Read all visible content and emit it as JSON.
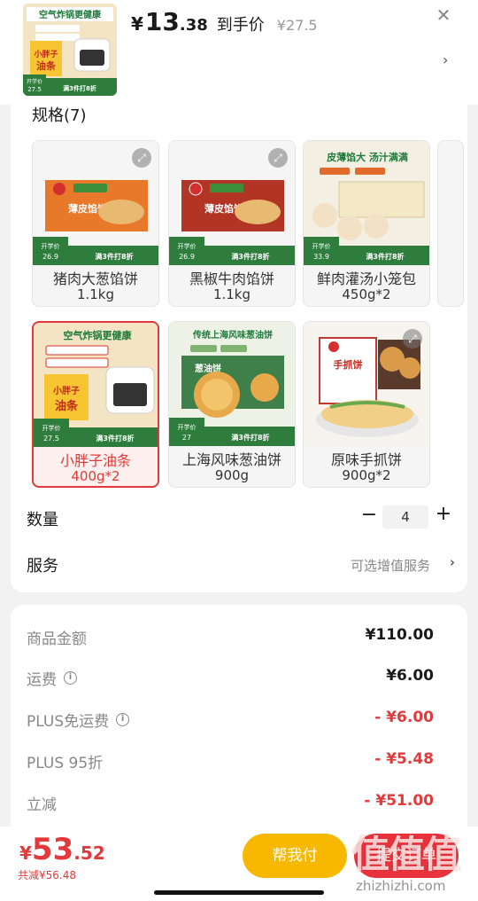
{
  "header": {
    "price_yen": "¥",
    "price_int": "13",
    "price_dec": ".38",
    "price_hand": "到手价",
    "price_orig": "¥27.5",
    "close_icon": "close-icon",
    "chevron_icon": "chevron-right-icon"
  },
  "spec": {
    "title": "规格(7)",
    "items": [
      {
        "name": "猪肉大葱馅饼",
        "sub": "1.1kg",
        "pkg_text": "薄皮馅饼",
        "band_label": "开学价",
        "band_price": "26.9",
        "promo": "满3件打8折",
        "selected": false
      },
      {
        "name": "黑椒牛肉馅饼",
        "sub": "1.1kg",
        "pkg_text": "薄皮馅饼",
        "band_label": "开学价",
        "band_price": "26.9",
        "promo": "满3件打8折",
        "selected": false
      },
      {
        "name": "鲜肉灌汤小笼包",
        "sub": "450g*2",
        "pkg_text": "皮薄馅大 汤汁满满",
        "band_label": "开学价",
        "band_price": "33.9",
        "promo": "满3件打8折",
        "selected": false
      },
      {
        "name": "小胖子油条",
        "sub": "400g*2",
        "pkg_text": "空气炸锅更健康",
        "band_label": "开学价",
        "band_price": "27.5",
        "promo": "满3件打8折",
        "selected": true
      },
      {
        "name": "上海风味葱油饼",
        "sub": "900g",
        "pkg_text": "传统上海风味葱油饼",
        "band_label": "开学价",
        "band_price": "27",
        "promo": "满3件打8折",
        "selected": false
      },
      {
        "name": "原味手抓饼",
        "sub": "900g*2",
        "pkg_text": "手抓饼",
        "band_label": "",
        "band_price": "",
        "promo": "",
        "selected": false
      }
    ]
  },
  "quantity": {
    "label": "数量",
    "minus": "−",
    "value": "4",
    "plus": "+"
  },
  "service": {
    "label": "服务",
    "value": "可选增值服务",
    "chevron": "›"
  },
  "breakdown": [
    {
      "label": "商品金额",
      "value": "¥110.00",
      "info": false,
      "red": false
    },
    {
      "label": "运费",
      "value": "¥6.00",
      "info": true,
      "red": false
    },
    {
      "label": "PLUS免运费",
      "value": "- ¥6.00",
      "info": true,
      "red": true
    },
    {
      "label": "PLUS 95折",
      "value": "- ¥5.48",
      "info": false,
      "red": true
    },
    {
      "label": "立减",
      "value": "- ¥51.00",
      "info": false,
      "red": true
    }
  ],
  "bottom": {
    "total_yen": "¥",
    "total_int": "53",
    "total_dec": ".52",
    "saved": "共减¥56.48",
    "help_btn": "帮我付",
    "submit_btn": "提交订单"
  },
  "watermark": {
    "text": "值值值",
    "url": "zhizhizhi.com"
  },
  "colors": {
    "accent_red": "#e23a3a",
    "help_yellow": "#f8b800",
    "band_green": "#2e7d3c"
  }
}
